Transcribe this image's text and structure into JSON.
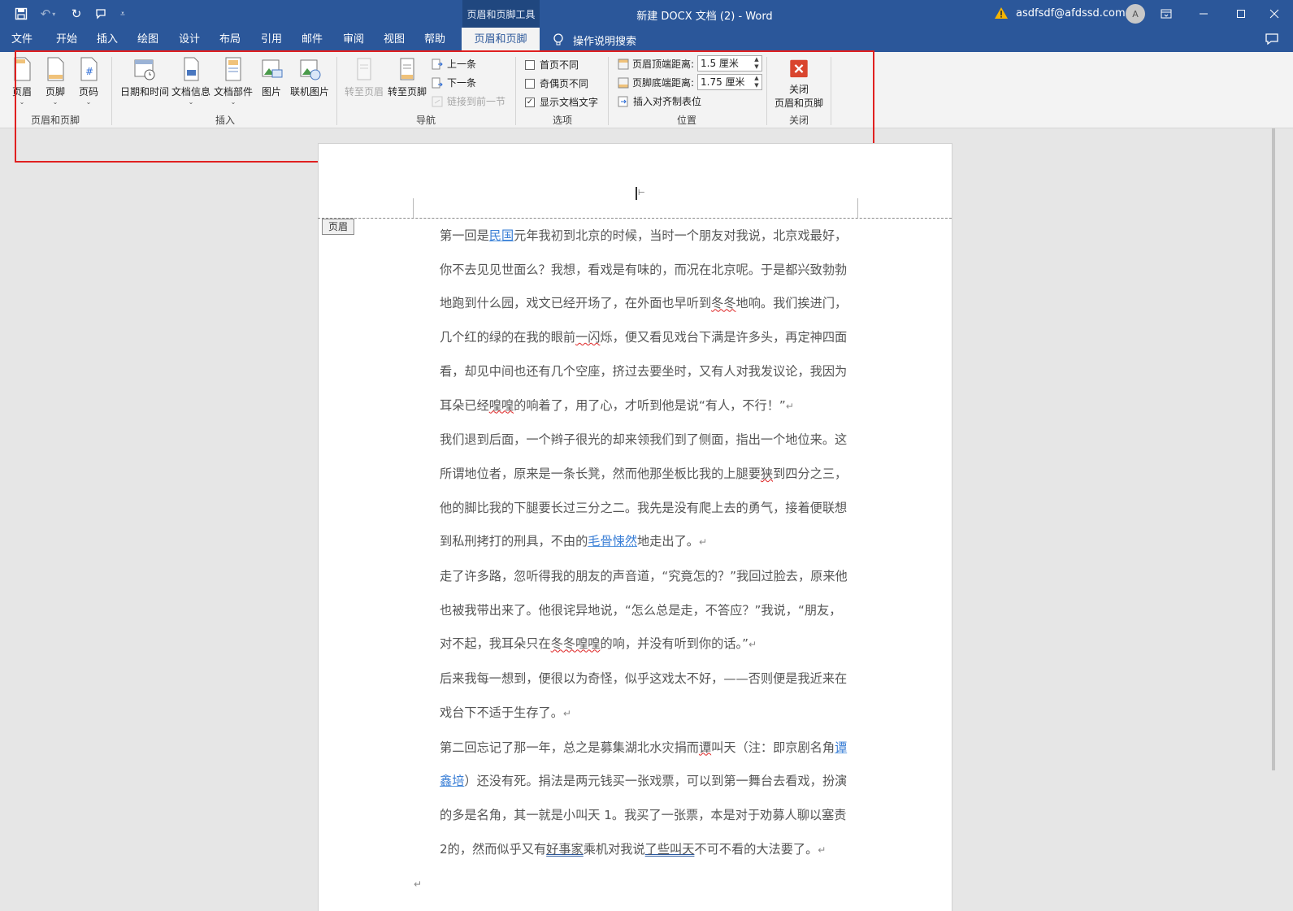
{
  "titlebar": {
    "contextual_tab": "页眉和页脚工具",
    "doc_title": "新建 DOCX 文档 (2)  -  Word",
    "account": "asdfsdf@afdssd.com",
    "avatar_initial": "A"
  },
  "tabs": {
    "file": "文件",
    "home": "开始",
    "insert": "插入",
    "draw": "绘图",
    "design": "设计",
    "layout": "布局",
    "references": "引用",
    "mailings": "邮件",
    "review": "审阅",
    "view": "视图",
    "help": "帮助",
    "header_footer": "页眉和页脚",
    "search": "操作说明搜索"
  },
  "ribbon": {
    "header": "页眉",
    "footer": "页脚",
    "page_number": "页码",
    "group_header_footer": "页眉和页脚",
    "date_time": "日期和时间",
    "doc_info": "文档信息",
    "doc_parts": "文档部件",
    "picture": "图片",
    "online_picture": "联机图片",
    "group_insert": "插入",
    "goto_header": "转至页眉",
    "goto_footer": "转至页脚",
    "previous": "上一条",
    "next": "下一条",
    "link_previous": "链接到前一节",
    "group_navigation": "导航",
    "diff_first_page": "首页不同",
    "diff_odd_even": "奇偶页不同",
    "show_doc_text": "显示文档文字",
    "show_doc_text_checked": true,
    "group_options": "选项",
    "header_from_top_label": "页眉顶端距离:",
    "header_from_top_value": "1.5 厘米",
    "footer_from_bottom_label": "页脚底端距离:",
    "footer_from_bottom_value": "1.75 厘米",
    "insert_align_tab": "插入对齐制表位",
    "group_position": "位置",
    "close_line1": "关闭",
    "close_line2": "页眉和页脚",
    "group_close": "关闭"
  },
  "document": {
    "header_tag": "页眉",
    "p1": [
      "第一回是",
      "民国",
      "元年我初到北京的时候，当时一个朋友对我说，北京戏最好，你不去见见世面么？我想，看戏是有味的，而况在北京呢。于是都兴致勃勃地跑到什么园，戏文已经开场了，在外面也早听到",
      "冬冬",
      "地响。我们挨进门，几个红的绿的在我的眼前",
      "一闪",
      "烁，便又看见戏台下满是许多头，再定神四面看，却见中间也还有几个空座，挤过去要坐时，又有人对我发议论，我因为耳朵已经",
      "喤喤",
      "的响着了，用了心，才听到他是说“有人，不行！”"
    ],
    "p2": [
      "我们退到后面，一个辫子很光的却来领我们到了侧面，指出一个地位来。这所谓地位者，原来是一条长凳，然而他那坐板比我的上腿要",
      "狭",
      "到四分之三，他的脚比我的下腿要长过三分之二。我先是没有爬上去的勇气，接着便联想到私刑拷打的刑具，不由的",
      "毛骨悚然",
      "地走出了。"
    ],
    "p3": [
      "走了许多路，忽听得我的朋友的声音道，“究竟怎的？”我回过脸去，原来他也被我带出来了。他很诧异地说，“怎么总是走，不答应？”我说，“朋友，对不起，我耳朵只在",
      "冬冬喤喤",
      "的响，并没有听到你的话。”"
    ],
    "p4": "后来我每一想到，便很以为奇怪，似乎这戏太不好，——否则便是我近来在戏台下不适于生存了。",
    "p5": [
      "第二回忘记了那一年，总之是募集湖北水灾捐而",
      "谭",
      "叫天（注：即京剧名角",
      "谭鑫培",
      "）还没有死。捐法是两元钱买一张戏票，可以到第一舞台去看戏，扮演的多是名角，其一就是小叫天 1。我买了一张票，本是对于劝募人聊以塞责 2的，然而似乎又有",
      "好事家",
      "乘机对我说",
      "了些叫天",
      "不可不看的大法要了。"
    ],
    "para_mark": "↵"
  }
}
